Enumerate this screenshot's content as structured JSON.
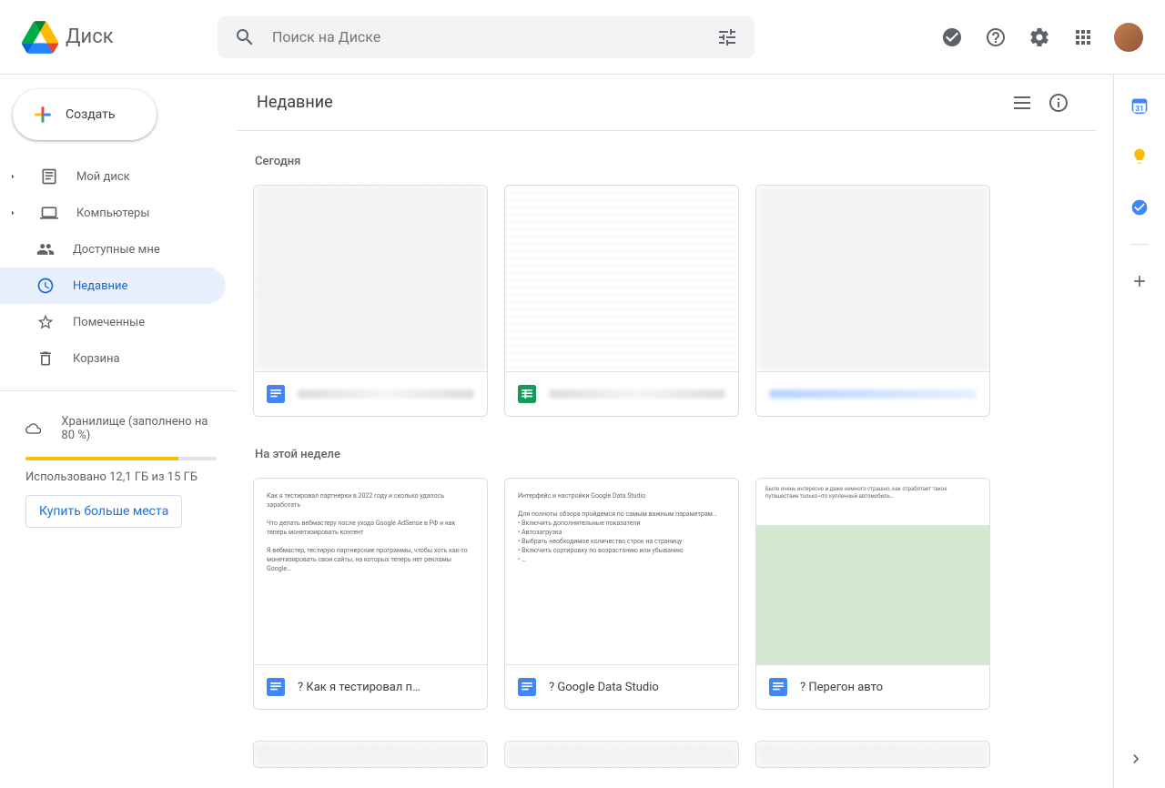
{
  "header": {
    "logo_text": "Диск",
    "search_placeholder": "Поиск на Диске"
  },
  "create_label": "Создать",
  "nav": {
    "my_drive": "Мой диск",
    "computers": "Компьютеры",
    "shared": "Доступные мне",
    "recent": "Недавние",
    "starred": "Помеченные",
    "trash": "Корзина"
  },
  "storage": {
    "title": "Хранилище (заполнено на 80 %)",
    "used": "Использовано 12,1 ГБ из 15 ГБ",
    "buy": "Купить больше места",
    "fill_pct": 80
  },
  "main_title": "Недавние",
  "sections": {
    "today": "Сегодня",
    "this_week": "На этой неделе"
  },
  "files": {
    "week": [
      {
        "name": "? Как я тестировал п…",
        "type": "doc"
      },
      {
        "name": "? Google Data Studio",
        "type": "doc"
      },
      {
        "name": "? Перегон авто",
        "type": "doc"
      }
    ]
  },
  "colors": {
    "docs_blue": "#4285f4",
    "sheets_green": "#0f9d58",
    "accent": "#1a73e8",
    "storage_bar": "#fbbc04"
  }
}
